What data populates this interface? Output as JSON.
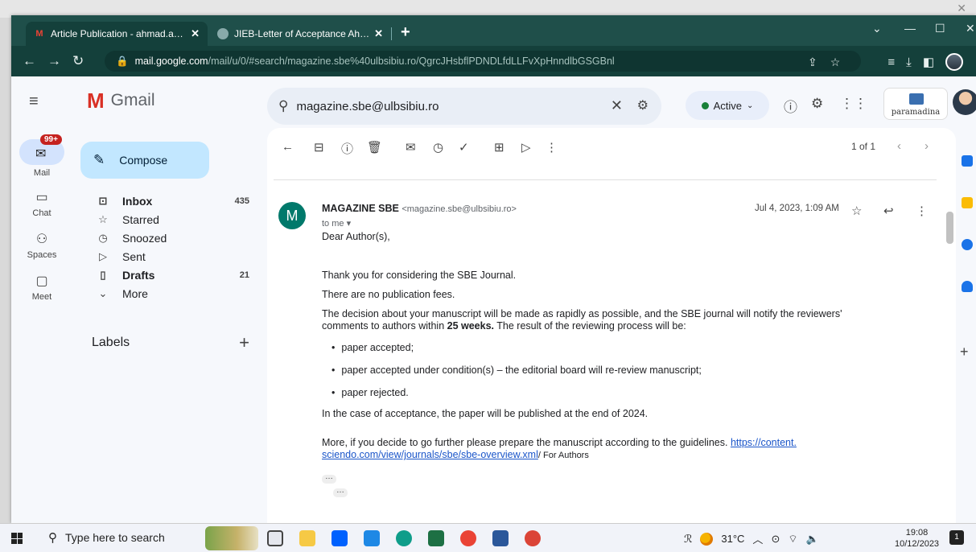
{
  "browser": {
    "tabs": [
      {
        "title": "Article Publication - ahmad.azmy",
        "active": true
      },
      {
        "title": "JIEB-Letter of Acceptance Ahmad",
        "active": false
      }
    ],
    "url_host": "mail.google.com",
    "url_path": "/mail/u/0/#search/magazine.sbe%40ulbsibiu.ro/QgrcJHsbflPDNDLfdLLFvXpHnndlbGSGBnl"
  },
  "gmail": {
    "app_name": "Gmail",
    "search_value": "magazine.sbe@ulbsibiu.ro",
    "status": "Active",
    "org_logo_text": "paramadina",
    "rail": [
      {
        "label": "Mail",
        "badge": "99+"
      },
      {
        "label": "Chat"
      },
      {
        "label": "Spaces"
      },
      {
        "label": "Meet"
      }
    ],
    "compose": "Compose",
    "folders": [
      {
        "label": "Inbox",
        "count": "435",
        "bold": true
      },
      {
        "label": "Starred",
        "count": ""
      },
      {
        "label": "Snoozed",
        "count": ""
      },
      {
        "label": "Sent",
        "count": ""
      },
      {
        "label": "Drafts",
        "count": "21",
        "bold": true
      },
      {
        "label": "More",
        "count": ""
      }
    ],
    "labels_heading": "Labels",
    "pager": "1 of 1"
  },
  "message": {
    "avatar_letter": "M",
    "sender_name": "MAGAZINE SBE",
    "sender_email": "<magazine.sbe@ulbsibiu.ro>",
    "to": "to me",
    "date": "Jul 4, 2023, 1:09 AM",
    "greeting": "Dear Author(s),",
    "p1": "Thank you for considering the SBE Journal.",
    "p2": "There are no publication fees.",
    "p3a": "The decision about your manuscript will be made as rapidly as possible, and the SBE journal will notify the reviewers'",
    "p3b": "comments to authors within ",
    "p3_bold": "25 weeks.",
    "p3c": " The result of the reviewing process will be:",
    "bullets": [
      "paper accepted;",
      "paper accepted under condition(s) – the editorial board will re-review manuscript;",
      "paper rejected."
    ],
    "p4": "In the case of acceptance, the paper will be published at the end of 2024.",
    "p5": "More, if you decide to go further please prepare the manuscript according to the guidelines. ",
    "link1": "https://content.",
    "link2": "sciendo.com/view/journals/sbe/sbe-overview.xml",
    "link_after": "/ For Authors"
  },
  "taskbar": {
    "search_placeholder": "Type here to search",
    "weather": "31°C",
    "time": "19:08",
    "date": "10/12/2023",
    "notif_count": "1"
  }
}
